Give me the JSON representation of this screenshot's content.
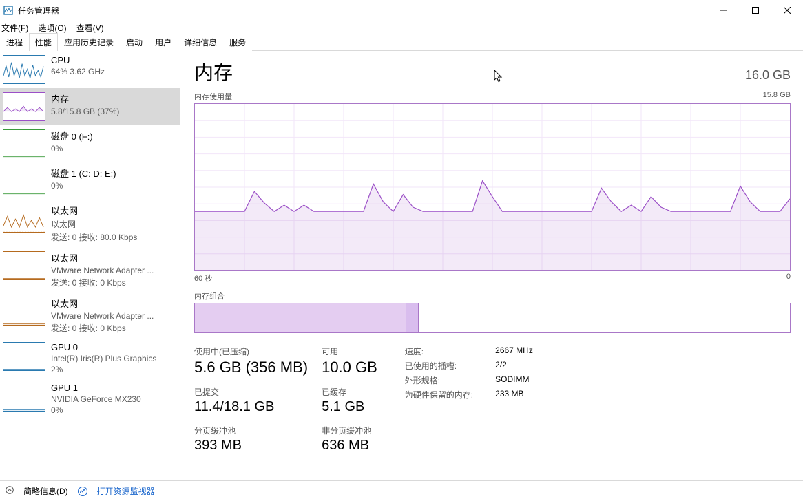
{
  "window": {
    "title": "任务管理器"
  },
  "menu": {
    "file": "文件(F)",
    "options": "选项(O)",
    "view": "查看(V)"
  },
  "tabs": [
    "进程",
    "性能",
    "应用历史记录",
    "启动",
    "用户",
    "详细信息",
    "服务"
  ],
  "active_tab": 1,
  "sidebar": {
    "items": [
      {
        "title": "CPU",
        "sub": "64% 3.62 GHz",
        "color": "#2a7ab0",
        "thumb_type": "cpu"
      },
      {
        "title": "内存",
        "sub": "5.8/15.8 GB (37%)",
        "color": "#9b4fc7",
        "thumb_type": "mem",
        "selected": true
      },
      {
        "title": "磁盘 0 (F:)",
        "sub": "0%",
        "color": "#3a9a3a",
        "thumb_type": "flat"
      },
      {
        "title": "磁盘 1 (C: D: E:)",
        "sub": "0%",
        "color": "#3a9a3a",
        "thumb_type": "flat"
      },
      {
        "title": "以太网",
        "sub": "以太网",
        "sub2": "发送: 0 接收: 80.0 Kbps",
        "color": "#b56a1e",
        "thumb_type": "eth"
      },
      {
        "title": "以太网",
        "sub": "VMware Network Adapter ...",
        "sub2": "发送: 0 接收: 0 Kbps",
        "color": "#b56a1e",
        "thumb_type": "flat"
      },
      {
        "title": "以太网",
        "sub": "VMware Network Adapter ...",
        "sub2": "发送: 0 接收: 0 Kbps",
        "color": "#b56a1e",
        "thumb_type": "flat"
      },
      {
        "title": "GPU 0",
        "sub": "Intel(R) Iris(R) Plus Graphics",
        "sub2": "2%",
        "color": "#2a7ab0",
        "thumb_type": "flat"
      },
      {
        "title": "GPU 1",
        "sub": "NVIDIA GeForce MX230",
        "sub2": "0%",
        "color": "#2a7ab0",
        "thumb_type": "flat"
      }
    ]
  },
  "detail": {
    "title": "内存",
    "total": "16.0 GB",
    "usage_label": "内存使用量",
    "usage_max_label": "15.8 GB",
    "axis_left": "60 秒",
    "axis_right": "0",
    "composition_label": "内存组合",
    "composition": {
      "used_frac": 0.355,
      "modified_frac": 0.02
    },
    "stats_left": [
      {
        "label": "使用中(已压缩)",
        "value": "5.6 GB (356 MB)",
        "size": "big"
      },
      {
        "label": "可用",
        "value": "10.0 GB",
        "size": "big"
      },
      {
        "label": "已提交",
        "value": "11.4/18.1 GB",
        "size": "med"
      },
      {
        "label": "已缓存",
        "value": "5.1 GB",
        "size": "med"
      },
      {
        "label": "分页缓冲池",
        "value": "393 MB",
        "size": "med"
      },
      {
        "label": "非分页缓冲池",
        "value": "636 MB",
        "size": "med"
      }
    ],
    "stats_right": [
      {
        "label": "速度:",
        "value": "2667 MHz"
      },
      {
        "label": "已使用的插槽:",
        "value": "2/2"
      },
      {
        "label": "外形规格:",
        "value": "SODIMM"
      },
      {
        "label": "为硬件保留的内存:",
        "value": "233 MB"
      }
    ]
  },
  "chart_data": {
    "type": "area",
    "title": "内存使用量",
    "ylabel": "GB",
    "ylim": [
      0,
      15.8
    ],
    "x_range_seconds": 60,
    "series": [
      {
        "name": "内存使用量 (GB)",
        "values": [
          5.6,
          5.6,
          5.6,
          5.6,
          5.6,
          5.6,
          7.5,
          6.4,
          5.6,
          6.2,
          5.6,
          6.2,
          5.6,
          5.6,
          5.6,
          5.6,
          5.6,
          5.6,
          8.2,
          6.5,
          5.6,
          7.2,
          6.0,
          5.6,
          5.6,
          5.6,
          5.6,
          5.6,
          5.6,
          8.5,
          7.0,
          5.6,
          5.6,
          5.6,
          5.6,
          5.6,
          5.6,
          5.6,
          5.6,
          5.6,
          5.6,
          7.8,
          6.5,
          5.6,
          6.2,
          5.6,
          7.0,
          6.0,
          5.6,
          5.6,
          5.6,
          5.6,
          5.6,
          5.6,
          5.6,
          8.0,
          6.5,
          5.6,
          5.6,
          5.6,
          6.8
        ]
      }
    ]
  },
  "footer": {
    "fewer": "简略信息(D)",
    "resmon": "打开资源监视器"
  }
}
